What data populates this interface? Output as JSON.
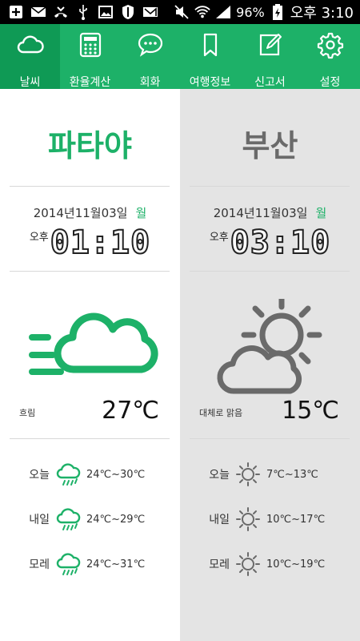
{
  "status_bar": {
    "battery": "96%",
    "time": "오후 3:10"
  },
  "tabs": [
    {
      "label": "날씨",
      "icon": "cloud-icon",
      "active": true
    },
    {
      "label": "환율계산",
      "icon": "calculator-icon",
      "active": false
    },
    {
      "label": "회화",
      "icon": "chat-bubble-icon",
      "active": false
    },
    {
      "label": "여행정보",
      "icon": "bookmark-icon",
      "active": false
    },
    {
      "label": "신고서",
      "icon": "edit-document-icon",
      "active": false
    },
    {
      "label": "설정",
      "icon": "gear-icon",
      "active": false
    }
  ],
  "left": {
    "city": "파타야",
    "date": "2014년11월03일",
    "dow": "월",
    "ampm": "오후",
    "time": "01:10",
    "condition": "흐림",
    "condition_icon": "windy-cloud-icon",
    "temperature": "27℃",
    "forecast": [
      {
        "day": "오늘",
        "icon": "rain-cloud-icon",
        "range": "24℃~30℃"
      },
      {
        "day": "내일",
        "icon": "rain-cloud-icon",
        "range": "24℃~29℃"
      },
      {
        "day": "모레",
        "icon": "rain-cloud-icon",
        "range": "24℃~31℃"
      }
    ]
  },
  "right": {
    "city": "부산",
    "date": "2014년11월03일",
    "dow": "월",
    "ampm": "오후",
    "time": "03:10",
    "condition": "대체로 맑음",
    "condition_icon": "partly-sunny-icon",
    "temperature": "15℃",
    "forecast": [
      {
        "day": "오늘",
        "icon": "sun-icon",
        "range": "7℃~13℃"
      },
      {
        "day": "내일",
        "icon": "sun-icon",
        "range": "10℃~17℃"
      },
      {
        "day": "모레",
        "icon": "sun-icon",
        "range": "10℃~19℃"
      }
    ]
  },
  "colors": {
    "accent": "#1db168",
    "active_tab": "#0f9a55",
    "right_bg": "#e4e4e4",
    "grey_icon": "#6a6a6a"
  }
}
